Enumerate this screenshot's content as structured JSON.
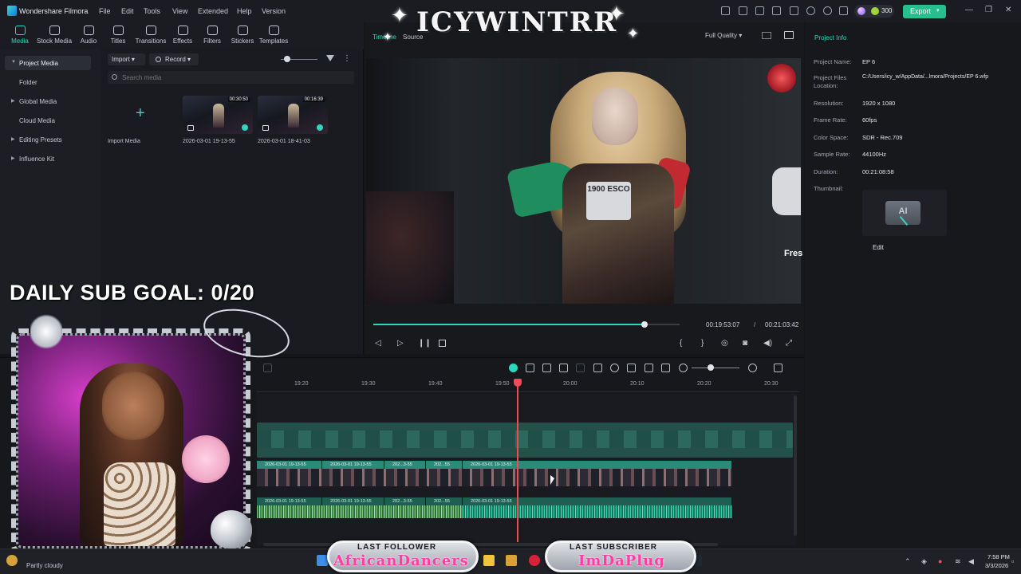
{
  "app": {
    "title": "Wondershare Filmora"
  },
  "menu": [
    "File",
    "Edit",
    "Tools",
    "View",
    "Extended",
    "Help",
    "Version"
  ],
  "header": {
    "credits": "300",
    "export_label": "Export"
  },
  "toolbar": {
    "tabs": [
      {
        "label": "Media",
        "icon": "media-icon"
      },
      {
        "label": "Stock Media",
        "icon": "stock-media-icon"
      },
      {
        "label": "Audio",
        "icon": "audio-icon"
      },
      {
        "label": "Titles",
        "icon": "titles-icon"
      },
      {
        "label": "Transitions",
        "icon": "transitions-icon"
      },
      {
        "label": "Effects",
        "icon": "effects-icon"
      },
      {
        "label": "Filters",
        "icon": "filters-icon"
      },
      {
        "label": "Stickers",
        "icon": "stickers-icon"
      },
      {
        "label": "Templates",
        "icon": "templates-icon"
      }
    ]
  },
  "sidebar": {
    "items": [
      "Project Media",
      "Folder",
      "Global Media",
      "Cloud Media",
      "Editing Presets",
      "Influence Kit"
    ]
  },
  "media": {
    "import_label": "Import",
    "record_label": "Record",
    "search_placeholder": "Search media",
    "import_media_label": "Import Media",
    "clips": [
      {
        "name": "2026-03-01 19-13-55",
        "duration": "00:30:50"
      },
      {
        "name": "2026-03-01 18-41-03",
        "duration": "00:16:39"
      }
    ]
  },
  "overlay": {
    "sub_goal": "DAILY SUB GOAL: 0/20",
    "channel_title": "ICYWINTRR",
    "weather": "Partly cloudy",
    "last_follower_title": "LAST FOLLOWER",
    "last_follower_name": "AfricanDancers",
    "last_subscriber_title": "LAST SUBSCRIBER",
    "last_subscriber_name": "ImDaPlug"
  },
  "preview": {
    "tab_timeline": "Timeline",
    "tab_source": "Source",
    "quality": "Full Quality",
    "current_time": "00:19:53:07",
    "separator": "/",
    "total_time": "00:21:03:42",
    "progress": 0.943,
    "video_plate": "1900 ESCO",
    "video_corner_text": "Fres"
  },
  "project_info": {
    "title": "Project Info",
    "fields": [
      {
        "key": "Project Name:",
        "value": "EP 6"
      },
      {
        "key": "Project Files Location:",
        "value": "C:/Users/icy_w/AppData/...lmora/Projects/EP 6.wfp"
      },
      {
        "key": "Resolution:",
        "value": "1920 x 1080"
      },
      {
        "key": "Frame Rate:",
        "value": "60fps"
      },
      {
        "key": "Color Space:",
        "value": "SDR - Rec.709"
      },
      {
        "key": "Sample Rate:",
        "value": "44100Hz"
      },
      {
        "key": "Duration:",
        "value": "00:21:08:58"
      },
      {
        "key": "Thumbnail:",
        "value": ""
      }
    ],
    "thumbnail_text": "AI",
    "edit_label": "Edit"
  },
  "timeline": {
    "ruler": [
      "19:20",
      "19:30",
      "19:40",
      "19:50",
      "20:00",
      "20:10",
      "20:20",
      "20:30"
    ],
    "video_clips": [
      {
        "label": "2026-03-01 19-13-55"
      },
      {
        "label": "2026-03-01 19-13-55"
      },
      {
        "label": "202...3-55"
      },
      {
        "label": "202...55"
      },
      {
        "label": "2026-03-01 19-13-55"
      }
    ],
    "audio_clips": [
      {
        "label": "2026-03-01 19-13-55"
      },
      {
        "label": "2026-03-01 19-13-55"
      },
      {
        "label": "202...3-55"
      },
      {
        "label": "202...55"
      },
      {
        "label": "2026-03-01 19-13-55"
      }
    ]
  },
  "taskbar": {
    "time": "7:58 PM",
    "date": "3/3/2026"
  },
  "colors": {
    "accent": "#2fd6bf",
    "export": "#25c08e",
    "playhead": "#f04a5c"
  }
}
